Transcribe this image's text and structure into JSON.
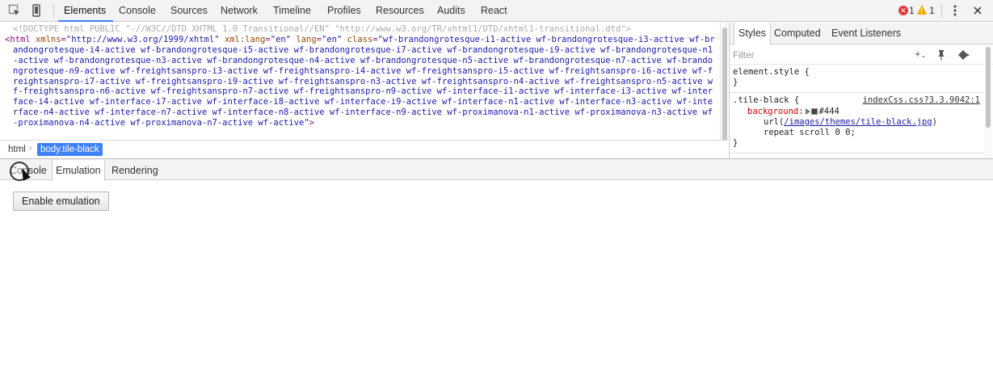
{
  "toolbar": {
    "tabs": [
      "Elements",
      "Console",
      "Sources",
      "Network",
      "Timeline",
      "Profiles",
      "Resources",
      "Audits",
      "React"
    ],
    "active_tab": "Elements",
    "errors": "1",
    "warnings": "1",
    "icons": [
      "inspect-element-icon",
      "device-mode-icon",
      "error-icon",
      "warning-icon",
      "more-options-icon",
      "close-icon"
    ]
  },
  "elements": {
    "doctype": "<!DOCTYPE html PUBLIC \"-//W3C//DTD XHTML 1.0 Transitional//EN\" \"http://www.w3.org/TR/xhtml1/DTD/xhtml1-transitional.dtd\">",
    "html_tag_open": "<html",
    "attr1_name": "xmlns",
    "attr1_value": "\"http://www.w3.org/1999/xhtml\"",
    "attr2_name": "xml:lang",
    "attr2_value": "\"en\"",
    "attr3_name": "lang",
    "attr3_value": "\"en\"",
    "attr4_name": "class",
    "class_value": "\"wf-brandongrotesque-i1-active wf-brandongrotesque-i3-active wf-brandongrotesque-i4-active wf-brandongrotesque-i5-active wf-brandongrotesque-i7-active wf-brandongrotesque-i9-active wf-brandongrotesque-n1-active wf-brandongrotesque-n3-active wf-brandongrotesque-n4-active wf-brandongrotesque-n5-active wf-brandongrotesque-n7-active wf-brandongrotesque-n9-active wf-freightsanspro-i3-active wf-freightsanspro-i4-active wf-freightsanspro-i5-active wf-freightsanspro-i6-active wf-freightsanspro-i7-active wf-freightsanspro-i9-active wf-freightsanspro-n3-active wf-freightsanspro-n4-active wf-freightsanspro-n5-active wf-freightsanspro-n6-active wf-freightsanspro-n7-active wf-freightsanspro-n9-active wf-interface-i1-active wf-interface-i3-active wf-interface-i4-active wf-interface-i7-active wf-interface-i8-active wf-interface-i9-active wf-interface-n1-active wf-interface-n3-active wf-interface-n4-active wf-interface-n7-active wf-interface-n8-active wf-interface-n9-active wf-proximanova-n1-active wf-proximanova-n3-active wf-proximanova-n4-active wf-proximanova-n7-active wf-active\"",
    "html_tag_close": ">"
  },
  "breadcrumbs": {
    "items": [
      "html",
      "body.tile-black"
    ],
    "selected": "body.tile-black"
  },
  "sidebar": {
    "tabs": [
      "Styles",
      "Computed",
      "Event Listeners"
    ],
    "active_tab": "Styles",
    "filter_placeholder": "Filter",
    "icons": [
      "new-style-rule-icon",
      "pin-icon",
      "toggle-element-state-icon"
    ],
    "rules": {
      "element_style_selector": "element.style {",
      "element_style_close": "}",
      "tile_selector": ".tile-black {",
      "tile_source": "indexCss.css?3.3.9042:1",
      "prop_name": "background:",
      "color_value": "#444",
      "url_prefix": "url(",
      "url_path": "/images/themes/tile-black.jpg",
      "url_suffix": ")",
      "repeat_line": "repeat scroll 0 0;",
      "tile_close": "}"
    }
  },
  "drawer": {
    "tabs": [
      "Console",
      "Emulation",
      "Rendering"
    ],
    "active_tab": "Emulation",
    "enable_button": "Enable emulation"
  },
  "colors": {
    "accent": "#3e82f7",
    "tag": "#881280",
    "attr_name": "#994500",
    "attr_value": "#1a1aa6",
    "prop_name": "#c80000",
    "error": "#e0383f",
    "warning": "#f2a600"
  }
}
